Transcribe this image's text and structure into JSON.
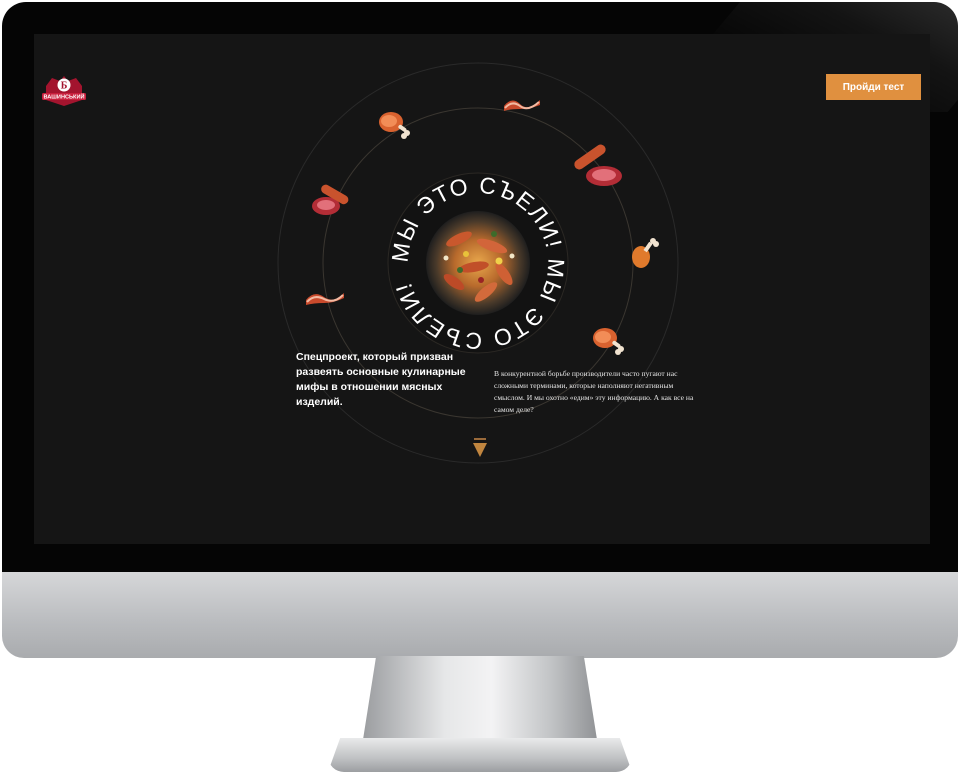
{
  "header": {
    "logo": {
      "icon": "vashinsky-logo-icon",
      "text": "ВАШИНСЬКИЙ",
      "badge": "Б"
    },
    "cta_label": "Пройди тест"
  },
  "hero": {
    "circle_text": "МЫ ЭТО СЪЕЛИ! МЫ ЭТО СЪЕЛИ!",
    "image": "sausage-plate-image",
    "headline": "Спецпроект, который призван развеять основные кулинарные мифы в отношении мясных изделий.",
    "paragraph": "В конкурентной борьбе производители часто пугают нас сложными терминами, которые наполняют негативным смыслом. И мы охотно «едим» эту информацию. А как все на самом деле?",
    "scroll_icon": "triangle-down-icon"
  },
  "orbit_icons": [
    "ham-icon",
    "bacon-icon",
    "sausage-steak-icon",
    "chicken-leg-icon",
    "ham-icon",
    "bacon-icon",
    "sausage-steak-icon"
  ],
  "colors": {
    "background": "#151515",
    "accent": "#e0903f",
    "text": "#ffffff"
  }
}
